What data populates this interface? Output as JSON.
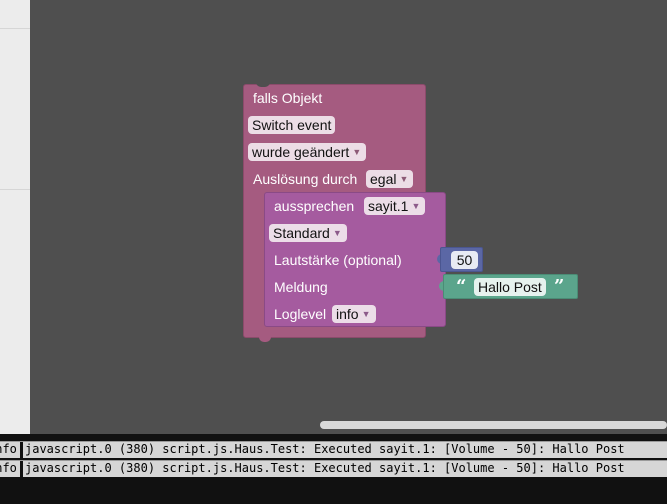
{
  "blocks": {
    "trigger": {
      "header": "falls Objekt",
      "object_field": "Switch event",
      "condition_value": "wurde geändert",
      "trigger_label": "Auslösung durch",
      "trigger_value": "egal"
    },
    "speak": {
      "label": "aussprechen",
      "instance_value": "sayit.1",
      "voice_value": "Standard",
      "volume_label": "Lautstärke (optional)",
      "volume_value": "50",
      "message_label": "Meldung",
      "message_value": "Hallo Post",
      "loglevel_label": "Loglevel",
      "loglevel_value": "info"
    }
  },
  "console": {
    "rows": [
      {
        "level": "info",
        "message": "javascript.0 (380) script.js.Haus.Test: Executed sayit.1: [Volume - 50]: Hallo Post"
      },
      {
        "level": "info",
        "message": "javascript.0 (380) script.js.Haus.Test: Executed sayit.1: [Volume - 50]: Hallo Post"
      }
    ]
  },
  "colors": {
    "workspace": "#4f4f4f",
    "trigger_block": "#a55b80",
    "speak_block": "#a55b9f",
    "number_block": "#5b67a5",
    "text_block": "#5ba58c"
  },
  "icons": {
    "dropdown": "triangle-down",
    "quote_open": "left-double-quote",
    "quote_close": "right-double-quote"
  }
}
